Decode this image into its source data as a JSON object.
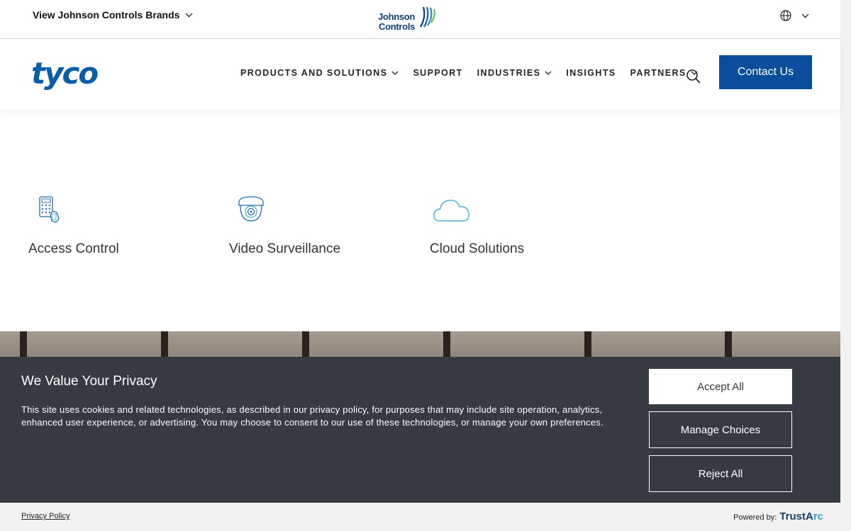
{
  "topbar": {
    "brands_label": "View Johnson Controls Brands",
    "jc_logo_line1": "Johnson",
    "jc_logo_line2": "Controls"
  },
  "nav": {
    "logo": "tyco",
    "links": [
      {
        "label": "PRODUCTS AND SOLUTIONS",
        "dropdown": true
      },
      {
        "label": "SUPPORT",
        "dropdown": false
      },
      {
        "label": "INDUSTRIES",
        "dropdown": true
      },
      {
        "label": "INSIGHTS",
        "dropdown": false
      },
      {
        "label": "PARTNERS",
        "dropdown": true
      }
    ],
    "contact_label": "Contact Us"
  },
  "tiles": [
    {
      "label": "Access Control",
      "icon": "keypad-icon"
    },
    {
      "label": "Video Surveillance",
      "icon": "camera-icon"
    },
    {
      "label": "Cloud Solutions",
      "icon": "cloud-icon"
    }
  ],
  "cookie": {
    "title": "We Value Your Privacy",
    "body": "This site uses cookies and related technologies, as described in our privacy policy, for purposes that may include site operation, analytics, enhanced user experience, or advertising. You may choose to consent to our use of these technologies, or manage your own preferences.",
    "accept_label": "Accept All",
    "manage_label": "Manage Choices",
    "reject_label": "Reject All"
  },
  "footer": {
    "privacy_label": "Privacy Policy",
    "powered_label": "Powered by:",
    "trustarc_1": "TrustA",
    "trustarc_2": "rc"
  },
  "colors": {
    "brand_blue": "#0a5ea8",
    "contact_button": "#0a4d9c",
    "banner_bg": "#363a43"
  }
}
